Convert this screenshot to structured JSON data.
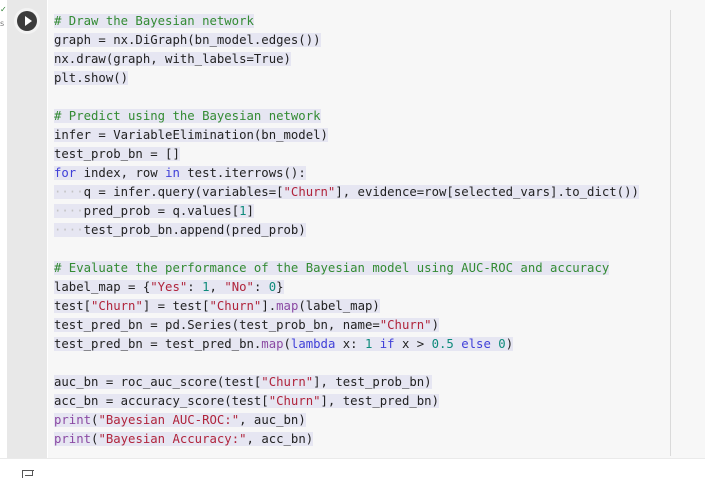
{
  "cell": {
    "status_mark": "✓",
    "status_sub": "s",
    "run_button_label": "run cell",
    "code_lines": [
      {
        "text": "# Draw the Bayesian network",
        "kind": "comment"
      },
      {
        "text": "graph = nx.DiGraph(bn_model.edges())",
        "kind": "code"
      },
      {
        "text": "nx.draw(graph, with_labels=True)",
        "kind": "code"
      },
      {
        "text": "plt.show()",
        "kind": "code"
      },
      {
        "text": "",
        "kind": "blank"
      },
      {
        "text": "# Predict using the Bayesian network",
        "kind": "comment"
      },
      {
        "text": "infer = VariableElimination(bn_model)",
        "kind": "code"
      },
      {
        "text": "test_prob_bn = []",
        "kind": "code"
      },
      {
        "text": "for index, row in test.iterrows():",
        "kind": "code"
      },
      {
        "text": "    q = infer.query(variables=[\"Churn\"], evidence=row[selected_vars].to_dict())",
        "kind": "code"
      },
      {
        "text": "    pred_prob = q.values[1]",
        "kind": "code"
      },
      {
        "text": "    test_prob_bn.append(pred_prob)",
        "kind": "code"
      },
      {
        "text": "",
        "kind": "blank"
      },
      {
        "text": "# Evaluate the performance of the Bayesian model using AUC-ROC and accuracy",
        "kind": "comment"
      },
      {
        "text": "label_map = {\"Yes\": 1, \"No\": 0}",
        "kind": "code"
      },
      {
        "text": "test[\"Churn\"] = test[\"Churn\"].map(label_map)",
        "kind": "code"
      },
      {
        "text": "test_pred_bn = pd.Series(test_prob_bn, name=\"Churn\")",
        "kind": "code"
      },
      {
        "text": "test_pred_bn = test_pred_bn.map(lambda x: 1 if x > 0.5 else 0)",
        "kind": "code"
      },
      {
        "text": "",
        "kind": "blank"
      },
      {
        "text": "auc_bn = roc_auc_score(test[\"Churn\"], test_prob_bn)",
        "kind": "code"
      },
      {
        "text": "acc_bn = accuracy_score(test[\"Churn\"], test_pred_bn)",
        "kind": "code"
      },
      {
        "text": "print(\"Bayesian AUC-ROC:\", auc_bn)",
        "kind": "code"
      },
      {
        "text": "print(\"Bayesian Accuracy:\", acc_bn)",
        "kind": "code"
      }
    ]
  },
  "colors": {
    "comment": "#338b33",
    "string": "#b0243b",
    "number": "#0d8a7a",
    "keyword": "#4040d8",
    "builtin": "#8b4aa3",
    "selection": "#e6e6f2",
    "editor_bg": "#f7f7f7"
  },
  "icons": {
    "run": "play-icon",
    "output": "output-icon"
  }
}
